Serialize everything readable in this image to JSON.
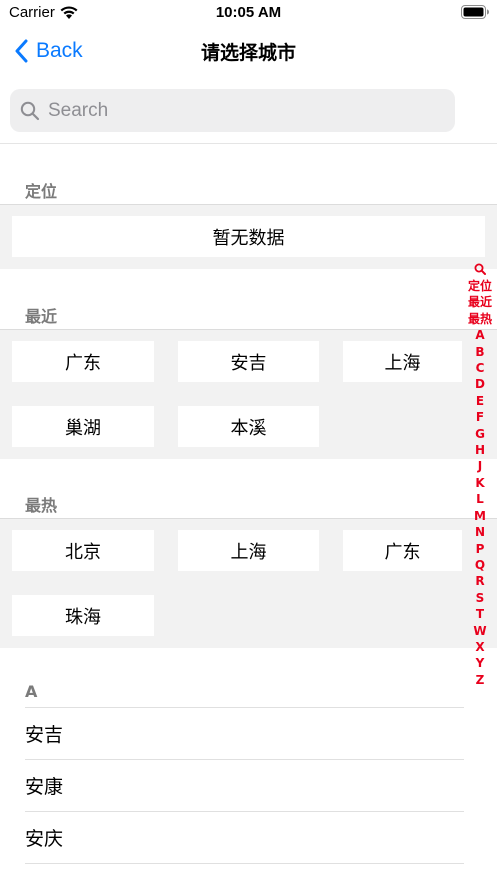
{
  "status_bar": {
    "carrier": "Carrier",
    "time": "10:05 AM"
  },
  "nav": {
    "back_label": "Back",
    "title": "请选择城市"
  },
  "search": {
    "placeholder": "Search"
  },
  "sections": {
    "location": {
      "header": "定位",
      "empty_text": "暂无数据"
    },
    "recent": {
      "header": "最近",
      "cities": [
        "广东",
        "安吉",
        "上海",
        "巢湖",
        "本溪"
      ]
    },
    "hot": {
      "header": "最热",
      "cities": [
        "北京",
        "上海",
        "广东",
        "珠海"
      ]
    },
    "a": {
      "header": "A",
      "cities": [
        "安吉",
        "安康",
        "安庆"
      ]
    }
  },
  "index_bar": [
    "定位",
    "最近",
    "最热",
    "A",
    "B",
    "C",
    "D",
    "E",
    "F",
    "G",
    "H",
    "J",
    "K",
    "L",
    "M",
    "N",
    "P",
    "Q",
    "R",
    "S",
    "T",
    "W",
    "X",
    "Y",
    "Z"
  ],
  "colors": {
    "accent": "#0a7aff",
    "index": "#e8001c",
    "section_bg": "#f2f2f2",
    "header_text": "#7b7b7b"
  }
}
